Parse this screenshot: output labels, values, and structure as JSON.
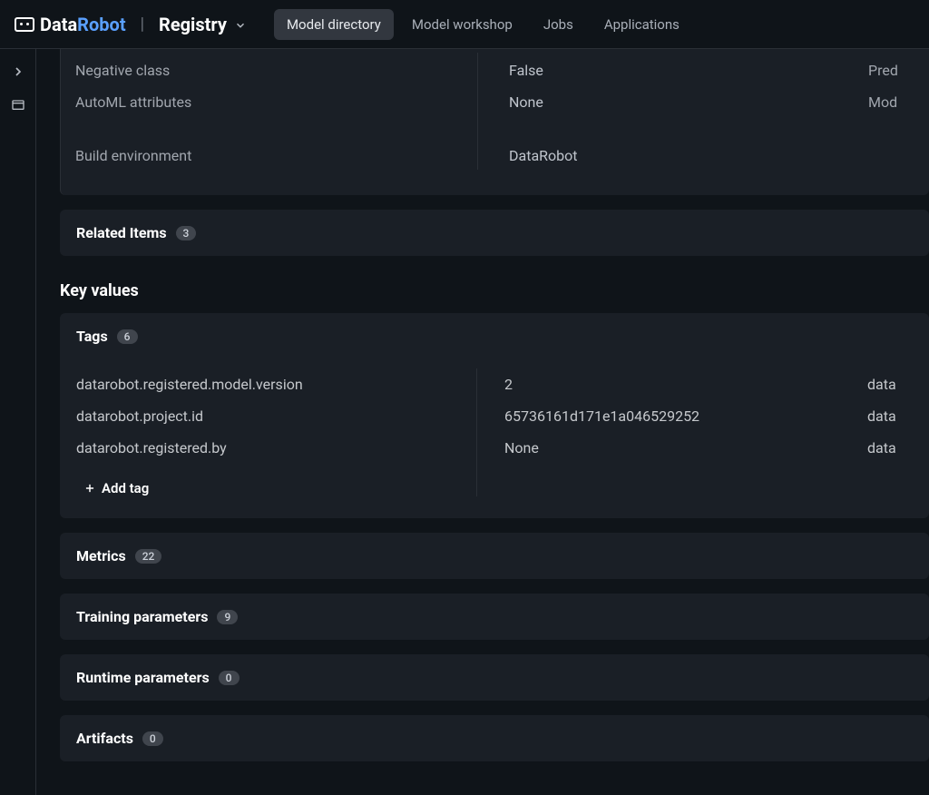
{
  "brand": {
    "data": "Data",
    "robot": "Robot"
  },
  "context": {
    "name": "Registry"
  },
  "nav": {
    "items": [
      {
        "label": "Model directory",
        "active": true
      },
      {
        "label": "Model workshop",
        "active": false
      },
      {
        "label": "Jobs",
        "active": false
      },
      {
        "label": "Applications",
        "active": false
      }
    ]
  },
  "properties": {
    "left": [
      {
        "label": "Negative class"
      },
      {
        "label": "AutoML attributes"
      },
      {
        "label": "Build environment"
      }
    ],
    "mid": [
      {
        "value": "False"
      },
      {
        "value": "None"
      },
      {
        "value": "DataRobot"
      }
    ],
    "right": [
      {
        "label": "Pred"
      },
      {
        "label": "Mod"
      }
    ]
  },
  "related": {
    "title": "Related Items",
    "count": "3"
  },
  "key_values_heading": "Key values",
  "tags": {
    "title": "Tags",
    "count": "6",
    "left": [
      "datarobot.registered.model.version",
      "datarobot.project.id",
      "datarobot.registered.by"
    ],
    "mid": [
      "2",
      "65736161d171e1a046529252",
      "None"
    ],
    "right": [
      "data",
      "data",
      "data"
    ],
    "add_label": "Add tag"
  },
  "metrics": {
    "title": "Metrics",
    "count": "22"
  },
  "training_params": {
    "title": "Training parameters",
    "count": "9"
  },
  "runtime_params": {
    "title": "Runtime parameters",
    "count": "0"
  },
  "artifacts": {
    "title": "Artifacts",
    "count": "0"
  }
}
